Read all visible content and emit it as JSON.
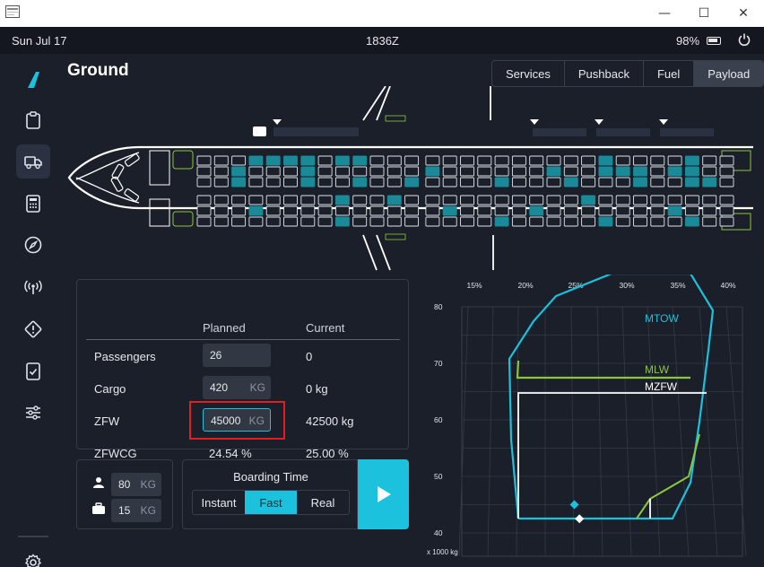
{
  "window": {
    "minimize_glyph": "—",
    "maximize_glyph": "☐",
    "close_glyph": "✕"
  },
  "status": {
    "date": "Sun Jul 17",
    "time": "1836Z",
    "battery": "98%"
  },
  "page": {
    "title": "Ground"
  },
  "tabs": [
    {
      "label": "Services",
      "active": false
    },
    {
      "label": "Pushback",
      "active": false
    },
    {
      "label": "Fuel",
      "active": false
    },
    {
      "label": "Payload",
      "active": true
    }
  ],
  "sidebar": {
    "items": [
      {
        "icon": "logo-icon"
      },
      {
        "icon": "clipboard-icon"
      },
      {
        "icon": "truck-icon",
        "active": true
      },
      {
        "icon": "calculator-icon"
      },
      {
        "icon": "compass-icon"
      },
      {
        "icon": "broadcast-icon"
      },
      {
        "icon": "warning-icon"
      },
      {
        "icon": "checklist-icon"
      },
      {
        "icon": "sliders-icon"
      },
      {
        "icon": "settings-icon"
      }
    ]
  },
  "payload": {
    "col_planned": "Planned",
    "col_current": "Current",
    "rows": [
      {
        "label": "Passengers",
        "planned": "26",
        "planned_unit": "",
        "current": "0"
      },
      {
        "label": "Cargo",
        "planned": "420",
        "planned_unit": "KG",
        "current": "0 kg"
      },
      {
        "label": "ZFW",
        "planned": "45000",
        "planned_unit": "KG",
        "current": "42500 kg"
      },
      {
        "label": "ZFWCG",
        "planned": "24.54 %",
        "planned_unit": "",
        "current": "25.00 %"
      }
    ]
  },
  "weights": {
    "pax_weight": "80",
    "pax_unit": "KG",
    "bag_weight": "15",
    "bag_unit": "KG"
  },
  "boarding": {
    "label": "Boarding Time",
    "options": [
      {
        "label": "Instant",
        "active": false
      },
      {
        "label": "Fast",
        "active": true
      },
      {
        "label": "Real",
        "active": false
      }
    ]
  },
  "colors": {
    "accent": "#1bc1dd",
    "occupied_seat": "#1a8a98",
    "mtow": "#1bc1dd",
    "mlw": "#8cc63f",
    "mzfw": "#ffffff",
    "highlight": "#e02020"
  },
  "chart_data": {
    "type": "scatter",
    "xlabel": "",
    "ylabel": "x 1000 kg",
    "x_ticks": [
      "15%",
      "20%",
      "25%",
      "30%",
      "35%",
      "40%"
    ],
    "y_ticks": [
      "80",
      "70",
      "60",
      "50",
      "40"
    ],
    "ylim": [
      40,
      80
    ],
    "limit_labels": [
      "MTOW",
      "MLW",
      "MZFW"
    ],
    "points": [
      {
        "name": "planned",
        "cg": 24.5,
        "weight": 45.0,
        "marker": "diamond",
        "color": "#1bc1dd"
      },
      {
        "name": "current",
        "cg": 25.0,
        "weight": 42.5,
        "marker": "diamond",
        "color": "#ffffff"
      }
    ]
  }
}
